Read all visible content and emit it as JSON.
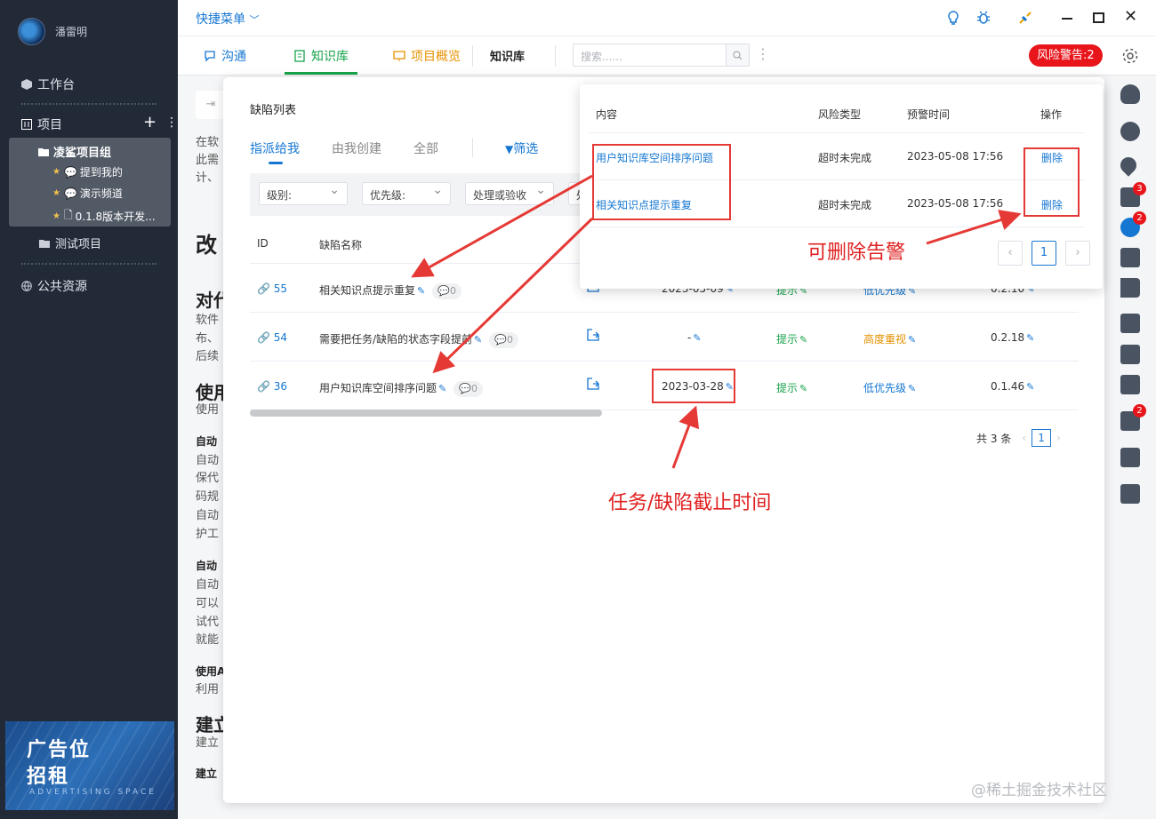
{
  "sidebar": {
    "user": "潘雷明",
    "workbench": "工作台",
    "projects": "项目",
    "group": {
      "title": "凌鲨项目组",
      "items": [
        "提到我的",
        "演示频道",
        "0.1.8版本开发..."
      ]
    },
    "test_project": "测试项目",
    "public": "公共资源",
    "ad": {
      "line1": "广告位",
      "line2": "招租",
      "line3": "ADVERTISING SPACE"
    }
  },
  "topbar": {
    "quick_menu": "快捷菜单"
  },
  "tabs": {
    "chat": "沟通",
    "knowledge": "知识库",
    "overview": "项目概览",
    "current": "知识库",
    "search_placeholder": "搜索......",
    "warning": "风险警告:2"
  },
  "right_strip_badges": [
    "3",
    "2",
    "2"
  ],
  "background_text": {
    "line1": "在软",
    "line2": "此需",
    "line3": "计、",
    "h1": "改",
    "h2": "对代",
    "p1": "软件",
    "p2": "布、",
    "p3": "后续",
    "h3": "使用",
    "p4": "使用",
    "s1": "自动",
    "p5": "自动",
    "p6": "保代",
    "p7": "码规",
    "p8": "自动",
    "p9": "护工",
    "s2": "自动",
    "p10": "自动",
    "p11": "可以",
    "p12": "试代",
    "p13": "就能",
    "s3": "使用A",
    "p14": "利用",
    "h4": "建立",
    "p15": "建立",
    "s4": "建立"
  },
  "defects": {
    "title": "缺陷列表",
    "tabs": [
      "指派给我",
      "由我创建",
      "全部"
    ],
    "filter": "筛选",
    "selects": [
      "级别:",
      "优先级:",
      "处理或验收",
      "处"
    ],
    "columns": {
      "id": "ID",
      "name": "缺陷名称"
    },
    "rows": [
      {
        "id": "55",
        "name": "相关知识点提示重复",
        "comments": "0",
        "deadline": "2023-05-09",
        "level": "提示",
        "priority": "低优先级",
        "version": "0.2.10"
      },
      {
        "id": "54",
        "name": "需要把任务/缺陷的状态字段提前",
        "comments": "0",
        "deadline": "-",
        "level": "提示",
        "priority": "高度重视",
        "version": "0.2.18"
      },
      {
        "id": "36",
        "name": "用户知识库空间排序问题",
        "comments": "0",
        "deadline": "2023-03-28",
        "level": "提示",
        "priority": "低优先级",
        "version": "0.1.46"
      }
    ],
    "total": "共 3 条",
    "page": "1"
  },
  "popup": {
    "columns": {
      "content": "内容",
      "type": "风险类型",
      "time": "预警时间",
      "action": "操作"
    },
    "rows": [
      {
        "content": "用户知识库空间排序问题",
        "type": "超时未完成",
        "time": "2023-05-08 17:56",
        "action": "删除"
      },
      {
        "content": "相关知识点提示重复",
        "type": "超时未完成",
        "time": "2023-05-08 17:56",
        "action": "删除"
      }
    ],
    "page": "1"
  },
  "annotations": {
    "deletable": "可删除告警",
    "deadline": "任务/缺陷截止时间"
  },
  "watermark": "@稀土掘金技术社区"
}
